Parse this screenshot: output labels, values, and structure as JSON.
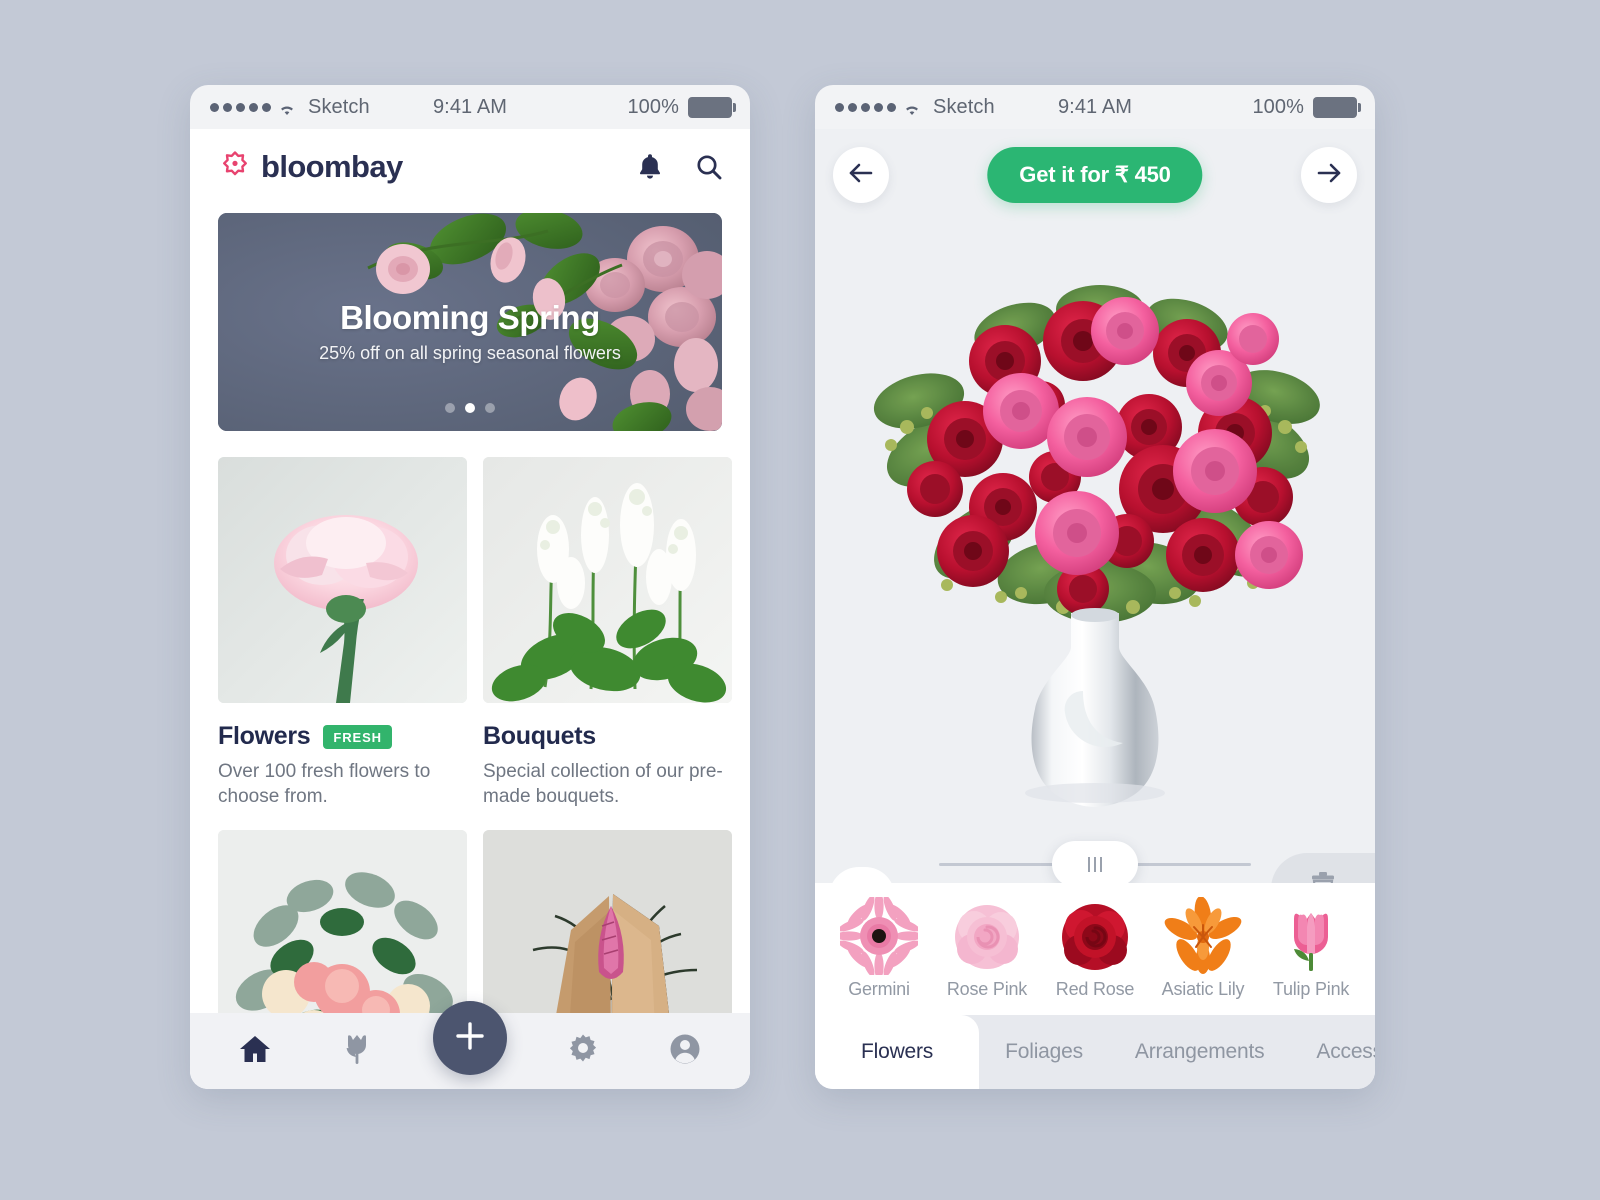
{
  "statusbar": {
    "carrier": "Sketch",
    "time": "9:41 AM",
    "battery_pct": "100%",
    "signal_icon": "signal-dots-icon",
    "wifi_icon": "wifi-icon",
    "battery_icon": "battery-full-icon"
  },
  "left": {
    "header": {
      "logo_icon": "bloombay-flower-logo-icon",
      "brand": "bloombay",
      "bell_icon": "bell-icon",
      "search_icon": "search-icon"
    },
    "banner": {
      "title": "Blooming Spring",
      "subtitle": "25% off on all spring seasonal flowers",
      "image_alt": "pink-roses-on-slate-background",
      "dots": 3,
      "active_dot": 2
    },
    "cards": [
      {
        "title": "Flowers",
        "badge": "FRESH",
        "description": "Over 100 fresh flowers to choose from.",
        "image_alt": "pink-carnation-single-stem"
      },
      {
        "title": "Bouquets",
        "badge": "",
        "description": "Special collection of our pre-made bouquets.",
        "image_alt": "white-stock-flowers-bunch"
      },
      {
        "title": "",
        "badge": "",
        "description": "",
        "image_alt": "pastel-carnation-eucalyptus-bouquet"
      },
      {
        "title": "",
        "badge": "",
        "description": "",
        "image_alt": "kraft-paper-wrapped-pink-tillandsia"
      }
    ],
    "tabbar": [
      {
        "name": "home",
        "icon": "home-icon",
        "active": true
      },
      {
        "name": "flowers",
        "icon": "tulip-icon",
        "active": false
      },
      {
        "name": "add",
        "icon": "plus-icon",
        "active": false
      },
      {
        "name": "settings",
        "icon": "gear-icon",
        "active": false
      },
      {
        "name": "profile",
        "icon": "user-circle-icon",
        "active": false
      }
    ]
  },
  "right": {
    "header": {
      "back_icon": "arrow-left-icon",
      "forward_icon": "arrow-right-icon",
      "price_label": "Get it for ₹ 450"
    },
    "hero": {
      "image_alt": "red-and-pink-rose-bouquet-in-silver-vase"
    },
    "slider": {
      "handle_icon": "drag-handle-icon",
      "collapse_icon": "chevron-up-icon",
      "delete_icon": "trash-icon"
    },
    "flowers": [
      {
        "label": "Germini",
        "icon": "gerbera-pink-icon"
      },
      {
        "label": "Rose Pink",
        "icon": "rose-pink-icon"
      },
      {
        "label": "Red Rose",
        "icon": "rose-red-icon"
      },
      {
        "label": "Asiatic Lily",
        "icon": "lily-orange-icon"
      },
      {
        "label": "Tulip Pink",
        "icon": "tulip-pink-icon"
      }
    ],
    "tabs": [
      {
        "label": "Flowers",
        "active": true
      },
      {
        "label": "Foliages",
        "active": false
      },
      {
        "label": "Arrangements",
        "active": false
      },
      {
        "label": "Accessories",
        "active": false
      }
    ]
  },
  "colors": {
    "page_bg": "#c3c9d6",
    "brand_navy": "#2a3052",
    "brand_pink": "#e8436f",
    "accent_green": "#2bb673",
    "badge_green": "#32b46c",
    "banner_slate": "#5b6476",
    "fab_slate": "#4c556f",
    "muted_text": "#6f7682"
  }
}
